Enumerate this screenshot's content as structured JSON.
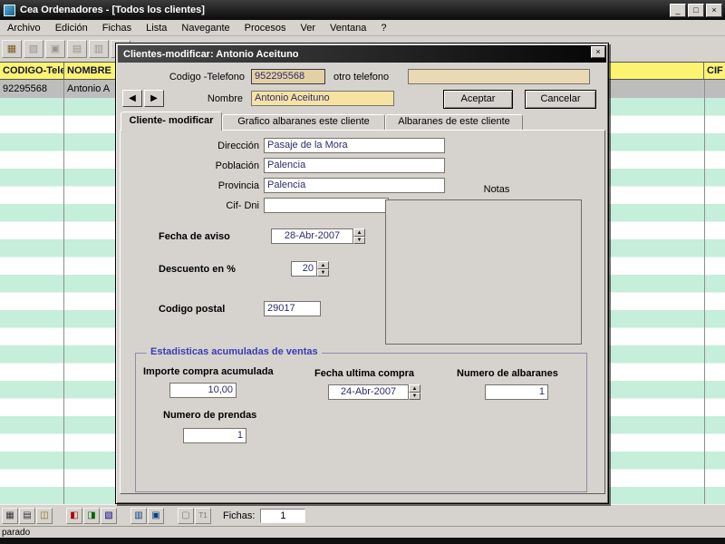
{
  "window": {
    "title": "Cea Ordenadores  - [Todos los clientes]",
    "menu": [
      "Archivo",
      "Edición",
      "Fichas",
      "Lista",
      "Navegante",
      "Procesos",
      "Ver",
      "Ventana",
      "?"
    ],
    "caption": {
      "minimize": "_",
      "maximize": "□",
      "close": "×"
    }
  },
  "top_toolbar": {
    "icons": [
      {
        "name": "new-record-icon",
        "glyph": "▦"
      },
      {
        "name": "cut-icon",
        "glyph": "▧"
      },
      {
        "name": "copy-icon",
        "glyph": "▣"
      },
      {
        "name": "paste-icon",
        "glyph": "▤"
      },
      {
        "name": "print-icon",
        "glyph": "▥"
      },
      {
        "name": "help-icon",
        "glyph": "?"
      }
    ]
  },
  "table": {
    "headers": [
      "CODIGO-Telefo",
      "NOMBRE",
      "CIF"
    ],
    "selected_row": {
      "codigo": "92295568",
      "nombre": "Antonio A"
    }
  },
  "dialog": {
    "title": "Clientes-modificar: Antonio Aceituno",
    "close": "×",
    "codigo_telefono": {
      "label": "Codigo -Telefono",
      "value": "952295568"
    },
    "otro_telefono": {
      "label": "otro telefono",
      "value": ""
    },
    "nombre": {
      "label": "Nombre",
      "value": "Antonio Aceituno"
    },
    "buttons": {
      "aceptar": "Aceptar",
      "cancelar": "Cancelar"
    },
    "tabs": [
      "Cliente- modificar",
      "Grafico albaranes este cliente",
      "Albaranes de este cliente"
    ],
    "fields": {
      "direccion": {
        "label": "Dirección",
        "value": "Pasaje de la Mora"
      },
      "poblacion": {
        "label": "Población",
        "value": "Palencia"
      },
      "provincia": {
        "label": "Provincia",
        "value": "Palencia"
      },
      "cif_dni": {
        "label": "Cif- Dni",
        "value": ""
      },
      "notas": {
        "label": "Notas",
        "value": ""
      },
      "fecha_aviso": {
        "label": "Fecha de aviso",
        "value": "28-Abr-2007"
      },
      "descuento": {
        "label": "Descuento en %",
        "value": "20"
      },
      "codigo_postal": {
        "label": "Codigo postal",
        "value": "29017"
      }
    },
    "stats": {
      "title": "Estadisticas acumuladas de ventas",
      "importe": {
        "label": "Importe compra acumulada",
        "value": "10,00"
      },
      "fecha_ultima": {
        "label": "Fecha ultima compra",
        "value": "24-Abr-2007"
      },
      "albaranes": {
        "label": "Numero de albaranes",
        "value": "1"
      },
      "prendas": {
        "label": "Numero de prendas",
        "value": "1"
      }
    }
  },
  "bottom_bar": {
    "icons": [
      {
        "name": "table-icon",
        "glyph": "▦",
        "color": "#333333"
      },
      {
        "name": "list-icon",
        "glyph": "▤",
        "color": "#333333"
      },
      {
        "name": "mail-icon",
        "glyph": "◫",
        "color": "#8a6d00"
      },
      {
        "name": "flag-red-icon",
        "glyph": "◧",
        "color": "#b00000"
      },
      {
        "name": "flag-green-icon",
        "glyph": "◨",
        "color": "#006600"
      },
      {
        "name": "flag-blue-icon",
        "glyph": "▧",
        "color": "#000080"
      },
      {
        "name": "chart-icon",
        "glyph": "▥",
        "color": "#004080"
      },
      {
        "name": "grid-icon",
        "glyph": "▣",
        "color": "#004080"
      },
      {
        "name": "blank-icon",
        "glyph": "▢",
        "color": "#777777"
      },
      {
        "name": "text-tool-icon",
        "glyph": "T1",
        "color": "#777777"
      }
    ],
    "fichas_label": "Fichas:",
    "fichas_value": "1"
  },
  "status": {
    "text": "parado"
  },
  "icons": {
    "prev": "◀",
    "next": "▶",
    "spin_up": "▲",
    "spin_down": "▼"
  },
  "colors": {
    "header_bg": "#fcf370",
    "stripe": "#c5eedb",
    "selected_row_bg": "#bdbdbd",
    "beige_field": "#ead9b5",
    "nombre_field": "#f6e3a4",
    "group_title": "#3b3bb5",
    "titlebar": "#1a1a1a"
  }
}
